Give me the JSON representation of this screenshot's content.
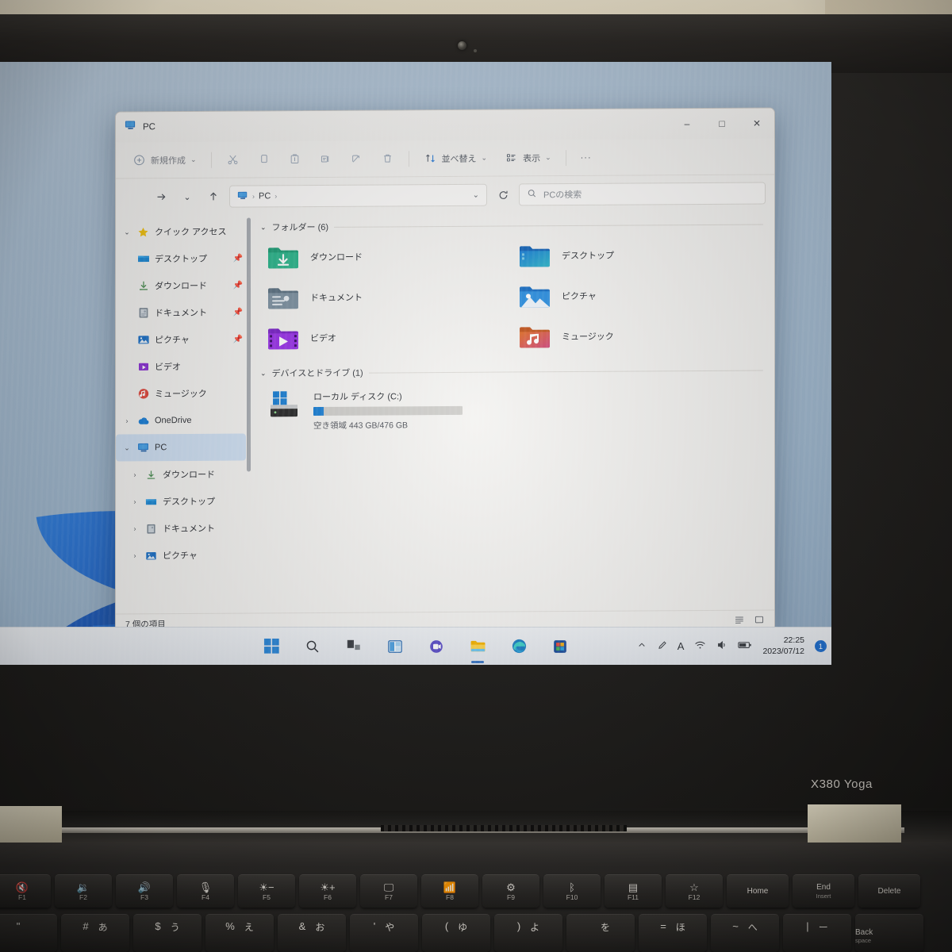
{
  "hardware": {
    "brand_label": "X380 Yoga",
    "webcam_icon": "webcam-icon"
  },
  "window": {
    "title": "PC",
    "title_icon": "this-pc-icon",
    "minimize": "–",
    "maximize": "□",
    "close": "✕"
  },
  "toolbar": {
    "new_label": "新規作成",
    "new_icon": "plus-circle-icon",
    "new_chevron": "⌄",
    "cut_icon": "scissors-icon",
    "copy_icon": "copy-icon",
    "paste_icon": "paste-icon",
    "rename_icon": "rename-icon",
    "share_icon": "share-icon",
    "delete_icon": "trash-icon",
    "sort_label": "並べ替え",
    "sort_icon": "sort-arrows-icon",
    "sort_chevron": "⌄",
    "view_label": "表示",
    "view_icon": "view-list-icon",
    "view_chevron": "⌄",
    "more_label": "···"
  },
  "addressbar": {
    "back_icon": "arrow-left-icon",
    "forward_icon": "arrow-right-icon",
    "recent_icon": "⌄",
    "up_icon": "arrow-up-icon",
    "crumb_icon": "this-pc-icon",
    "crumb_root": "PC",
    "crumb_sep1": "›",
    "crumb_sep2": "›",
    "crumb_dropdown": "⌄",
    "refresh_icon": "refresh-icon",
    "search_icon": "search-icon",
    "search_placeholder": "PCの検索",
    "search_value": ""
  },
  "sidebar": {
    "quick_access": {
      "label": "クイック アクセス",
      "icon": "star-icon",
      "chevron": "⌄"
    },
    "quick_items": [
      {
        "label": "デスクトップ",
        "icon": "desktop-folder-icon",
        "pinned": "📌"
      },
      {
        "label": "ダウンロード",
        "icon": "downloads-folder-icon",
        "pinned": "📌"
      },
      {
        "label": "ドキュメント",
        "icon": "documents-folder-icon",
        "pinned": "📌"
      },
      {
        "label": "ピクチャ",
        "icon": "pictures-folder-icon",
        "pinned": "📌"
      },
      {
        "label": "ビデオ",
        "icon": "videos-folder-icon",
        "pinned": ""
      },
      {
        "label": "ミュージック",
        "icon": "music-folder-icon",
        "pinned": ""
      }
    ],
    "onedrive": {
      "label": "OneDrive",
      "icon": "onedrive-icon",
      "chevron": "›"
    },
    "pc": {
      "label": "PC",
      "icon": "this-pc-icon",
      "chevron": "⌄"
    },
    "pc_children": [
      {
        "label": "ダウンロード",
        "icon": "downloads-folder-icon",
        "chevron": "›"
      },
      {
        "label": "デスクトップ",
        "icon": "desktop-folder-icon",
        "chevron": "›"
      },
      {
        "label": "ドキュメント",
        "icon": "documents-folder-icon",
        "chevron": "›"
      },
      {
        "label": "ピクチャ",
        "icon": "pictures-folder-icon",
        "chevron": "›"
      }
    ]
  },
  "content": {
    "folders_group": {
      "label": "フォルダー (6)",
      "chevron": "⌄"
    },
    "folders": [
      {
        "label": "ダウンロード",
        "icon": "downloads-folder-icon"
      },
      {
        "label": "デスクトップ",
        "icon": "desktop-folder-icon"
      },
      {
        "label": "ドキュメント",
        "icon": "documents-folder-icon"
      },
      {
        "label": "ピクチャ",
        "icon": "pictures-folder-icon"
      },
      {
        "label": "ビデオ",
        "icon": "videos-folder-icon"
      },
      {
        "label": "ミュージック",
        "icon": "music-folder-icon"
      }
    ],
    "devices_group": {
      "label": "デバイスとドライブ (1)",
      "chevron": "⌄"
    },
    "drive": {
      "name": "ローカル ディスク (C:)",
      "icon": "windows-drive-icon",
      "free_text": "空き領域 443 GB/476 GB",
      "used_percent": 7,
      "bar_color": "#1b7fd4"
    }
  },
  "statusbar": {
    "item_count": "7 個の項目",
    "list_view_icon": "list-view-icon",
    "detail_view_icon": "detail-view-icon"
  },
  "taskbar": {
    "items": [
      {
        "name": "start-button",
        "icon": "windows-logo-icon",
        "active": false
      },
      {
        "name": "search-button",
        "icon": "search-icon",
        "active": false
      },
      {
        "name": "task-view-button",
        "icon": "task-view-icon",
        "active": false
      },
      {
        "name": "widgets-button",
        "icon": "widgets-icon",
        "active": false
      },
      {
        "name": "chat-button",
        "icon": "chat-icon",
        "active": false
      },
      {
        "name": "file-explorer-button",
        "icon": "file-explorer-icon",
        "active": true
      },
      {
        "name": "edge-button",
        "icon": "edge-icon",
        "active": false
      },
      {
        "name": "store-button",
        "icon": "microsoft-store-icon",
        "active": false
      }
    ],
    "tray": {
      "overflow_icon": "chevron-up-icon",
      "pen_icon": "pen-icon",
      "ime_label": "A",
      "wifi_icon": "wifi-icon",
      "volume_icon": "volume-icon",
      "battery_icon": "battery-icon",
      "time": "22:25",
      "date": "2023/07/12",
      "notification_count": "1"
    }
  },
  "keyboard": {
    "function_row": [
      {
        "glyph": "🔇",
        "label": "F1"
      },
      {
        "glyph": "🔉",
        "label": "F2"
      },
      {
        "glyph": "🔊",
        "label": "F3"
      },
      {
        "glyph": "🎙",
        "label": "F4"
      },
      {
        "glyph": "☀−",
        "label": "F5"
      },
      {
        "glyph": "☀+",
        "label": "F6"
      },
      {
        "glyph": "🖵",
        "label": "F7"
      },
      {
        "glyph": "📶",
        "label": "F8"
      },
      {
        "glyph": "⚙",
        "label": "F9"
      },
      {
        "glyph": "ᛒ",
        "label": "F10"
      },
      {
        "glyph": "▤",
        "label": "F11"
      },
      {
        "glyph": "☆",
        "label": "F12"
      }
    ],
    "nav_keys": [
      {
        "top": "Home",
        "sub": ""
      },
      {
        "top": "End",
        "sub": "Insert"
      },
      {
        "top": "Delete",
        "sub": ""
      }
    ],
    "number_row": [
      {
        "sym": "\"",
        "kana": ""
      },
      {
        "sym": "#",
        "kana": "あ"
      },
      {
        "sym": "$",
        "kana": "う"
      },
      {
        "sym": "%",
        "kana": "え"
      },
      {
        "sym": "&",
        "kana": "お"
      },
      {
        "sym": "'",
        "kana": "や"
      },
      {
        "sym": "(",
        "kana": "ゆ"
      },
      {
        "sym": ")",
        "kana": "よ"
      },
      {
        "sym": "",
        "kana": "を"
      },
      {
        "sym": "=",
        "kana": "ほ"
      },
      {
        "sym": "~",
        "kana": "へ"
      },
      {
        "sym": "|",
        "kana": "ー"
      }
    ],
    "backspace": {
      "top": "Back",
      "sub": "space"
    }
  }
}
